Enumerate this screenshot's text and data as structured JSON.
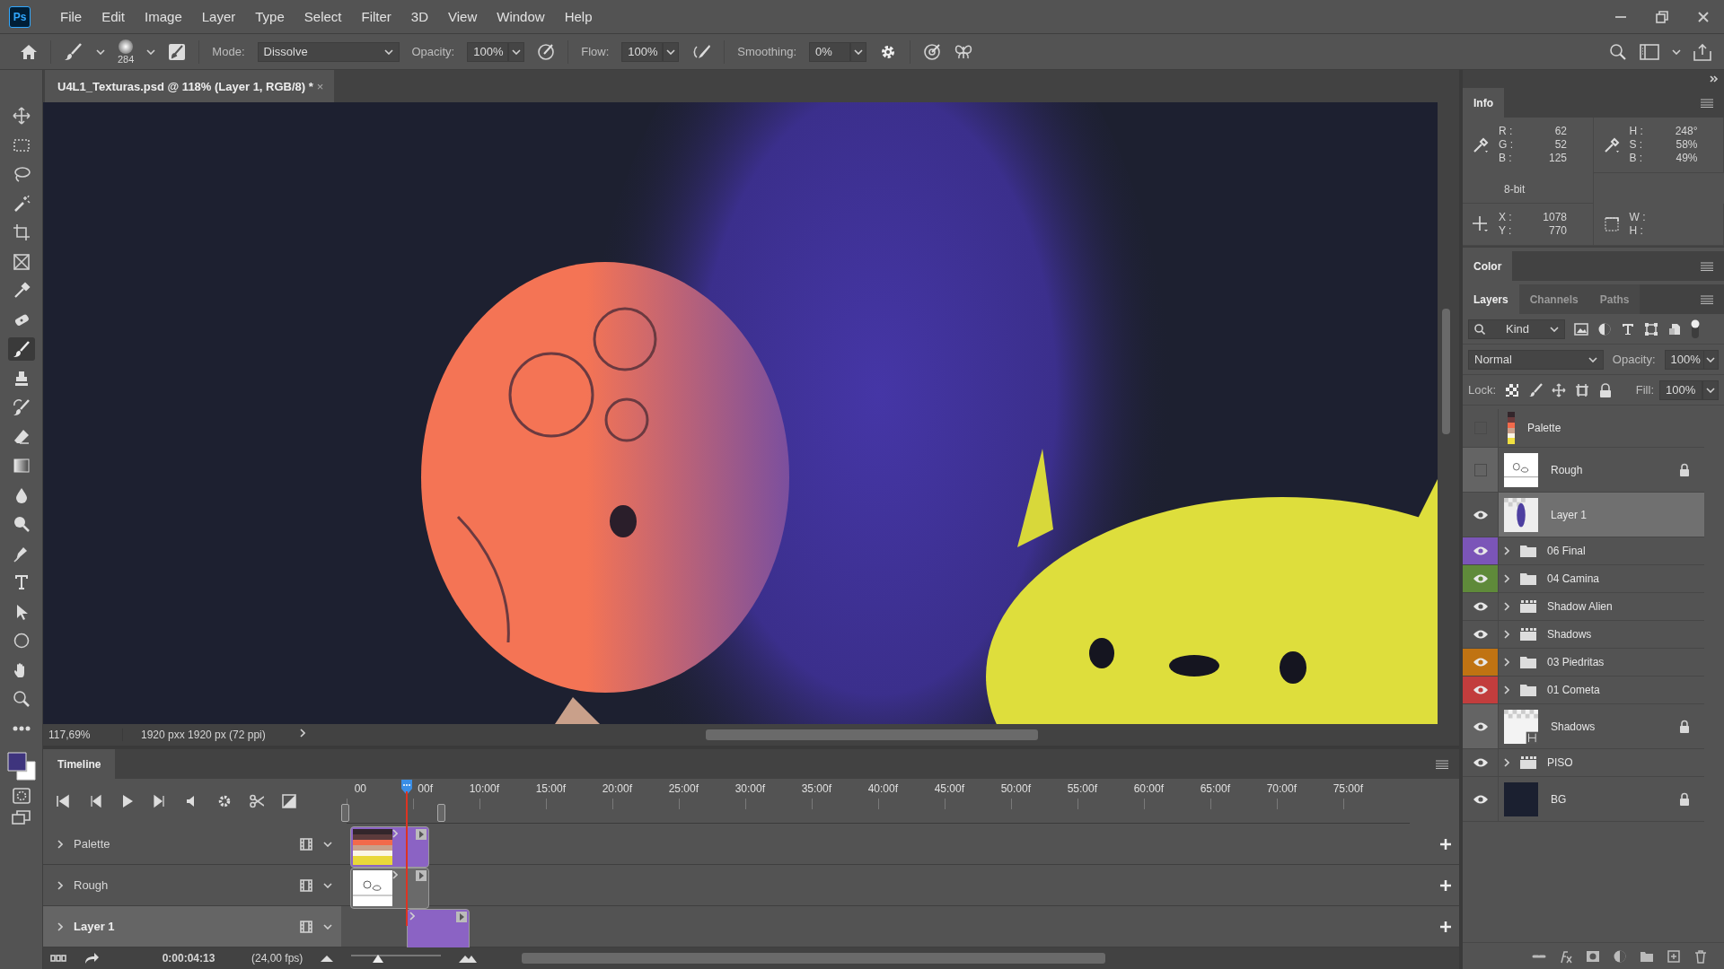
{
  "app": {
    "logo": "Ps"
  },
  "menu": [
    "File",
    "Edit",
    "Image",
    "Layer",
    "Type",
    "Select",
    "Filter",
    "3D",
    "View",
    "Window",
    "Help"
  ],
  "options_bar": {
    "brush_size": "284",
    "mode_label": "Mode:",
    "mode": "Dissolve",
    "opacity_label": "Opacity:",
    "opacity": "100%",
    "flow_label": "Flow:",
    "flow": "100%",
    "smoothing_label": "Smoothing:",
    "smoothing": "0%"
  },
  "document_tab": {
    "title": "U4L1_Texturas.psd @ 118% (Layer 1, RGB/8) *",
    "close": "×"
  },
  "tools": [
    {
      "kind": "move",
      "selected": false
    },
    {
      "kind": "marquee",
      "selected": false
    },
    {
      "kind": "lasso",
      "selected": false
    },
    {
      "kind": "wand",
      "selected": false
    },
    {
      "kind": "crop",
      "selected": false
    },
    {
      "kind": "frame",
      "selected": false
    },
    {
      "kind": "eyedropper",
      "selected": false
    },
    {
      "kind": "healing",
      "selected": false
    },
    {
      "kind": "brush",
      "selected": true
    },
    {
      "kind": "stamp",
      "selected": false
    },
    {
      "kind": "history",
      "selected": false
    },
    {
      "kind": "eraser",
      "selected": false
    },
    {
      "kind": "gradient",
      "selected": false
    },
    {
      "kind": "blur",
      "selected": false
    },
    {
      "kind": "dodge",
      "selected": false
    },
    {
      "kind": "pen",
      "selected": false
    },
    {
      "kind": "type",
      "selected": false
    },
    {
      "kind": "select",
      "selected": false
    },
    {
      "kind": "shape",
      "selected": false
    },
    {
      "kind": "hand",
      "selected": false
    },
    {
      "kind": "zoom",
      "selected": false
    },
    {
      "kind": "more",
      "selected": false
    }
  ],
  "swatches": [
    {
      "kind": "foreground",
      "color": "#3e347d"
    },
    {
      "kind": "background",
      "color": "#ffffff"
    }
  ],
  "canvas": {
    "kind": "picture"
  },
  "status_bar": {
    "zoom": "117,69%",
    "doc_size": "1920 pxx 1920 px (72 ppi)"
  },
  "timeline": {
    "title": "Timeline",
    "ruler": [
      "00",
      "00f",
      "10:00f",
      "15:00f",
      "20:00f",
      "25:00f",
      "30:00f",
      "35:00f",
      "40:00f",
      "45:00f",
      "50:00f",
      "55:00f",
      "60:00f",
      "65:00f",
      "70:00f",
      "75:00f"
    ],
    "playhead": {
      "level": 0.057
    },
    "tracks": [
      {
        "name": "Palette",
        "kind": "palette",
        "selected": false,
        "color": "#8b63c4"
      },
      {
        "name": "Rough",
        "kind": "sketch",
        "selected": false,
        "color": "#6a6a6a"
      },
      {
        "name": "Layer 1",
        "kind": "layer",
        "selected": true,
        "color": "#8b63c4"
      }
    ],
    "current_time": "0:00:04:13",
    "frame_rate": "(24,00 fps)",
    "zoom_slider": {
      "level": 0.3
    }
  },
  "info": {
    "title": "Info",
    "rgb": [
      {
        "label": "R :",
        "value": "62"
      },
      {
        "label": "G :",
        "value": "52"
      },
      {
        "label": "B :",
        "value": "125"
      }
    ],
    "hsb": [
      {
        "label": "H :",
        "value": "248°"
      },
      {
        "label": "S :",
        "value": "58%"
      },
      {
        "label": "B :",
        "value": "49%"
      }
    ],
    "bit_depth": "8-bit",
    "position": [
      {
        "label": "X :",
        "value": "1078"
      },
      {
        "label": "Y :",
        "value": "770"
      }
    ],
    "size": [
      {
        "label": "W :"
      },
      {
        "label": "H :"
      }
    ]
  },
  "color_panel": {
    "title": "Color"
  },
  "layers_panel": {
    "tabs": [
      {
        "label": "Layers",
        "selected": true
      },
      {
        "label": "Channels",
        "selected": false
      },
      {
        "label": "Paths",
        "selected": false
      }
    ],
    "filter": "Kind",
    "blend_mode": "Normal",
    "opacity_label": "Opacity:",
    "opacity": "100%",
    "lock_label": "Lock:",
    "fill_label": "Fill:",
    "fill": "100%",
    "layers": [
      {
        "name": "Palette",
        "kind": "palette",
        "visible": false,
        "selected": false,
        "locked": false
      },
      {
        "name": "Rough",
        "kind": "sketch",
        "visible": false,
        "selected": false,
        "locked": true
      },
      {
        "name": "Layer 1",
        "kind": "paint",
        "visible": true,
        "selected": true,
        "locked": false
      },
      {
        "name": "06 Final",
        "kind": "group",
        "visible": true,
        "selected": false,
        "locked": false,
        "color": "#7b55b8"
      },
      {
        "name": "04 Camina",
        "kind": "group",
        "visible": true,
        "selected": false,
        "locked": false,
        "color": "#5f8a3a"
      },
      {
        "name": "Shadow Alien",
        "kind": "video-group",
        "visible": true,
        "selected": false,
        "locked": false
      },
      {
        "name": "Shadows",
        "kind": "video-group",
        "visible": true,
        "selected": false,
        "locked": false
      },
      {
        "name": "03 Piedritas",
        "kind": "group",
        "visible": true,
        "selected": false,
        "locked": false,
        "color": "#c07312"
      },
      {
        "name": "01 Cometa",
        "kind": "group",
        "visible": true,
        "selected": false,
        "locked": false,
        "color": "#c23d3d"
      },
      {
        "name": "Shadows",
        "kind": "transparent",
        "visible": true,
        "selected": false,
        "locked": true
      },
      {
        "name": "PISO",
        "kind": "video-group",
        "visible": true,
        "selected": false,
        "locked": false
      },
      {
        "name": "BG",
        "kind": "solid",
        "visible": true,
        "selected": false,
        "locked": true
      }
    ]
  }
}
